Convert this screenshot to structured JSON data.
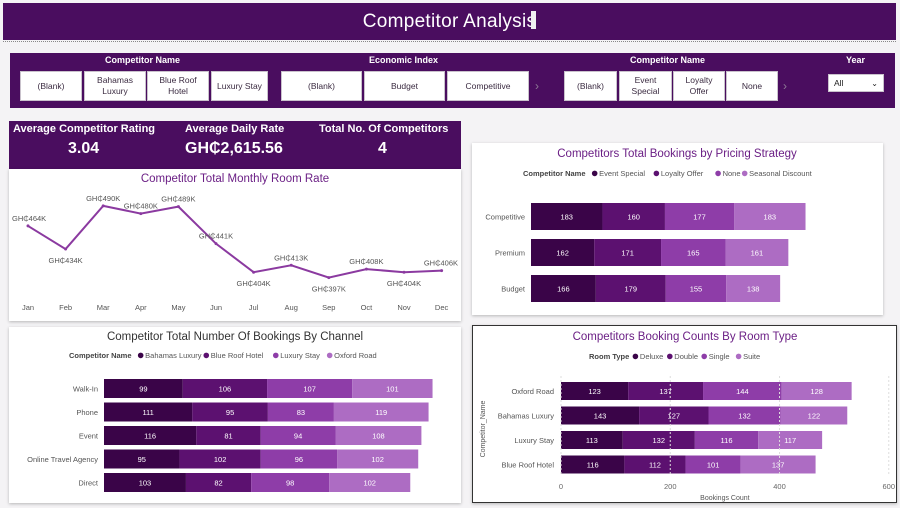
{
  "header": {
    "title": "Competitor Analysis"
  },
  "slicers": {
    "competitor_name_1": {
      "title": "Competitor Name",
      "options": [
        "(Blank)",
        "Bahamas Luxury",
        "Blue Roof Hotel",
        "Luxury Stay"
      ]
    },
    "economic_index": {
      "title": "Economic Index",
      "options": [
        "(Blank)",
        "Budget",
        "Competitive"
      ]
    },
    "competitor_name_2": {
      "title": "Competitor Name",
      "options": [
        "(Blank)",
        "Event Special",
        "Loyalty Offer",
        "None"
      ]
    },
    "year": {
      "title": "Year",
      "selected": "All"
    }
  },
  "kpis": {
    "avg_rating_label": "Average Competitor Rating",
    "avg_rating_value": "3.04",
    "adr_label": "Average Daily Rate",
    "adr_value": "GH₵2,615.56",
    "total_label": "Total No. Of Competitors",
    "total_value": "4"
  },
  "colors": {
    "header": "#4a0d5f",
    "s1": "#3a0448",
    "s2": "#5c1170",
    "s3": "#8e3da8",
    "s4": "#ad6cc3",
    "line": "#8b3aa0",
    "title_text": "#6b1f85"
  },
  "chart_data": [
    {
      "id": "monthly_rate",
      "type": "line",
      "title": "Competitor Total Monthly Room Rate",
      "categories": [
        "Jan",
        "Feb",
        "Mar",
        "Apr",
        "May",
        "Jun",
        "Jul",
        "Aug",
        "Sep",
        "Oct",
        "Nov",
        "Dec"
      ],
      "values": [
        464,
        434,
        490,
        480,
        489,
        441,
        404,
        413,
        397,
        408,
        404,
        406
      ],
      "labels": [
        "GH₵464K",
        "GH₵434K",
        "GH₵490K",
        "GH₵480K",
        "GH₵489K",
        "GH₵441K",
        "GH₵404K",
        "GH₵413K",
        "GH₵397K",
        "GH₵408K",
        "GH₵404K",
        "GH₵406K"
      ],
      "ylim": [
        390,
        495
      ]
    },
    {
      "id": "pricing_strategy",
      "type": "bar",
      "stacked": true,
      "orientation": "horizontal",
      "title": "Competitors Total Bookings by Pricing Strategy",
      "legend_title": "Competitor Name",
      "categories": [
        "Competitive",
        "Premium",
        "Budget"
      ],
      "series": [
        {
          "name": "Event Special",
          "values": [
            183,
            162,
            166
          ]
        },
        {
          "name": "Loyalty Offer",
          "values": [
            160,
            171,
            179
          ]
        },
        {
          "name": "None",
          "values": [
            177,
            165,
            155
          ]
        },
        {
          "name": "Seasonal Discount",
          "values": [
            183,
            161,
            138
          ]
        }
      ]
    },
    {
      "id": "channel",
      "type": "bar",
      "stacked": true,
      "orientation": "horizontal",
      "title": "Competitor Total Number Of Bookings By Channel",
      "legend_title": "Competitor Name",
      "categories": [
        "Walk-In",
        "Phone",
        "Event",
        "Online Travel Agency",
        "Direct"
      ],
      "series": [
        {
          "name": "Bahamas Luxury",
          "values": [
            99,
            111,
            116,
            95,
            103
          ]
        },
        {
          "name": "Blue Roof Hotel",
          "values": [
            106,
            95,
            81,
            102,
            82
          ]
        },
        {
          "name": "Luxury Stay",
          "values": [
            107,
            83,
            94,
            96,
            98
          ]
        },
        {
          "name": "Oxford Road",
          "values": [
            101,
            119,
            108,
            102,
            102
          ]
        }
      ]
    },
    {
      "id": "room_type",
      "type": "bar",
      "stacked": true,
      "orientation": "horizontal",
      "title": "Competitors Booking Counts By Room Type",
      "legend_title": "Room Type",
      "categories": [
        "Oxford Road",
        "Bahamas Luxury",
        "Luxury Stay",
        "Blue Roof Hotel"
      ],
      "series": [
        {
          "name": "Deluxe",
          "values": [
            123,
            143,
            113,
            116
          ]
        },
        {
          "name": "Double",
          "values": [
            137,
            127,
            132,
            112
          ]
        },
        {
          "name": "Single",
          "values": [
            144,
            132,
            116,
            101
          ]
        },
        {
          "name": "Suite",
          "values": [
            128,
            122,
            117,
            137
          ]
        }
      ],
      "xlabel": "Bookings Count",
      "ylabel": "Competitor_Name",
      "xticks": [
        "0",
        "200",
        "400",
        "600"
      ],
      "xlim": [
        0,
        600
      ]
    }
  ]
}
